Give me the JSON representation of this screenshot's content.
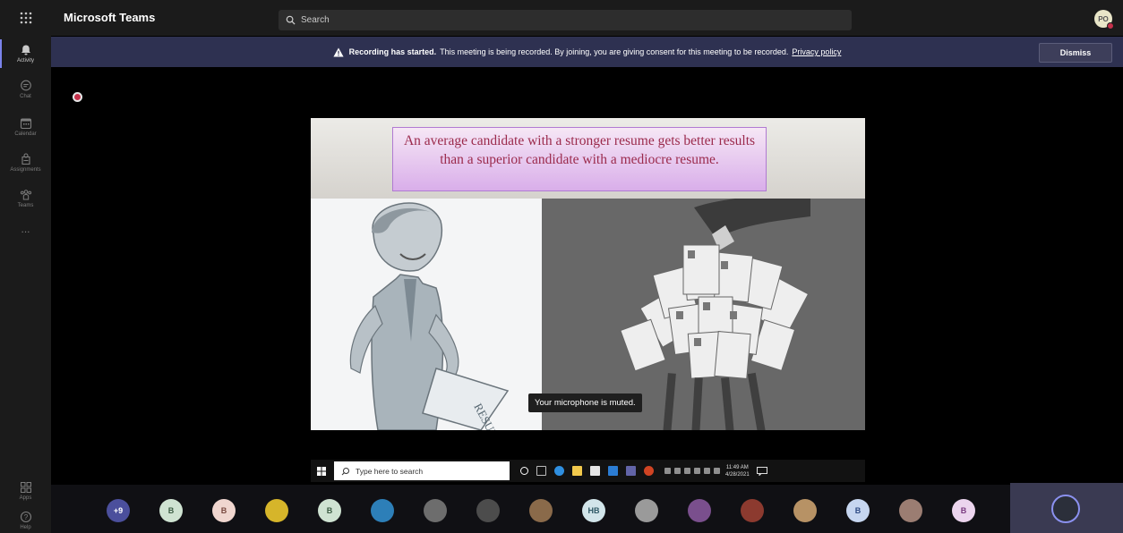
{
  "app": {
    "title": "Microsoft Teams"
  },
  "search": {
    "placeholder": "Search"
  },
  "me": {
    "initials": "PO"
  },
  "rail": {
    "items": [
      {
        "label": "Activity",
        "icon": "bell-icon"
      },
      {
        "label": "Chat",
        "icon": "chat-icon"
      },
      {
        "label": "Calendar",
        "icon": "calendar-icon"
      },
      {
        "label": "Assignments",
        "icon": "assignments-icon"
      },
      {
        "label": "Teams",
        "icon": "teams-icon"
      }
    ],
    "more": "...",
    "bottom": [
      {
        "label": "Apps",
        "icon": "apps-icon"
      },
      {
        "label": "Help",
        "icon": "help-icon"
      }
    ]
  },
  "banner": {
    "bold": "Recording has started.",
    "text": "This meeting is being recorded. By joining, you are giving consent for this meeting to be recorded.",
    "link": "Privacy policy",
    "dismiss": "Dismiss"
  },
  "slide": {
    "quote": "An average candidate with a stronger resume gets better results than a superior candidate with a mediocre resume.",
    "paper_text": "RESUME"
  },
  "toast": "Your microphone is muted.",
  "taskbar": {
    "search_placeholder": "Type here to search",
    "time": "11:49 AM",
    "date": "4/28/2021"
  },
  "participants": [
    {
      "label": "+9",
      "bg": "#4b4f9c",
      "fg": "#ffffff"
    },
    {
      "label": "B",
      "bg": "#cfe3d2",
      "fg": "#3b5c43"
    },
    {
      "label": "B",
      "bg": "#f0d6cf",
      "fg": "#7a4a40"
    },
    {
      "label": "",
      "bg": "#d6b52a",
      "fg": "#000000"
    },
    {
      "label": "B",
      "bg": "#cfe3d2",
      "fg": "#3b5c43"
    },
    {
      "label": "",
      "bg": "#2d7fb8",
      "fg": "#ffffff"
    },
    {
      "label": "",
      "bg": "#6d6d6d",
      "fg": "#ffffff"
    },
    {
      "label": "",
      "bg": "#4c4c4c",
      "fg": "#ffffff"
    },
    {
      "label": "",
      "bg": "#8a6a4a",
      "fg": "#ffffff"
    },
    {
      "label": "HB",
      "bg": "#d2e5ea",
      "fg": "#2f5966"
    },
    {
      "label": "",
      "bg": "#9a9a9a",
      "fg": "#ffffff"
    },
    {
      "label": "",
      "bg": "#7a4f8d",
      "fg": "#ffffff"
    },
    {
      "label": "",
      "bg": "#8c3a2f",
      "fg": "#ffffff"
    },
    {
      "label": "",
      "bg": "#b79265",
      "fg": "#ffffff"
    },
    {
      "label": "B",
      "bg": "#c6d6f0",
      "fg": "#2f4c85"
    },
    {
      "label": "",
      "bg": "#9b7d72",
      "fg": "#ffffff"
    },
    {
      "label": "B",
      "bg": "#ecd5ee",
      "fg": "#7a3b80"
    }
  ]
}
